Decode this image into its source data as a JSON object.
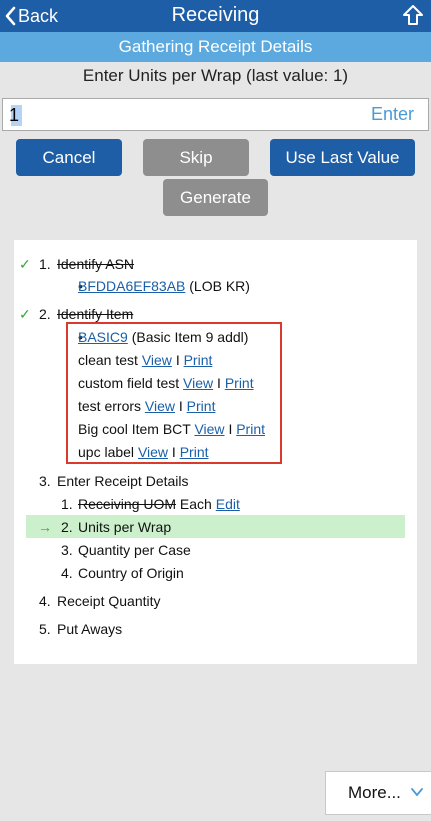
{
  "header": {
    "back_label": "Back",
    "title": "Receiving",
    "home_icon": "home-up-arrow-icon",
    "back_icon": "chevron-left-icon"
  },
  "subheader": {
    "title": "Gathering Receipt Details"
  },
  "prompt": {
    "text": "Enter Units per Wrap (last value: 1)"
  },
  "input": {
    "value": "1",
    "enter_label": "Enter"
  },
  "buttons": {
    "cancel": "Cancel",
    "skip": "Skip",
    "use_last": "Use Last Value",
    "generate": "Generate"
  },
  "steps": {
    "s1": {
      "num": "1.",
      "label": "Identify ASN",
      "asn_link": "BFDDA6EF83AB",
      "asn_note": "(LOB KR)"
    },
    "s2": {
      "num": "2.",
      "label": "Identify Item",
      "item_link": "BASIC9",
      "item_note": "(Basic Item 9 addl)",
      "labels": [
        {
          "name": "clean test",
          "view": "View",
          "sep": "I",
          "print": "Print"
        },
        {
          "name": "custom field test",
          "view": "View",
          "sep": "I",
          "print": "Print"
        },
        {
          "name": "test errors",
          "view": "View",
          "sep": "I",
          "print": "Print"
        },
        {
          "name": "Big cool Item BCT",
          "view": "View",
          "sep": "I",
          "print": "Print"
        },
        {
          "name": "upc label",
          "view": "View",
          "sep": "I",
          "print": "Print"
        }
      ]
    },
    "s3": {
      "num": "3.",
      "label": "Enter Receipt Details",
      "sub": [
        {
          "num": "1.",
          "label": "Receiving UOM",
          "value": "Each",
          "edit": "Edit"
        },
        {
          "num": "2.",
          "label": "Units per Wrap"
        },
        {
          "num": "3.",
          "label": "Quantity per Case"
        },
        {
          "num": "4.",
          "label": "Country of Origin"
        }
      ]
    },
    "s4": {
      "num": "4.",
      "label": "Receipt Quantity"
    },
    "s5": {
      "num": "5.",
      "label": "Put Aways"
    },
    "check_mark": "✓",
    "current_arrow": "→",
    "accent_green": "#3aa63a",
    "highlight_color": "#ccf0cc"
  },
  "more": {
    "label": "More...",
    "icon": "chevron-down-icon"
  },
  "colors": {
    "primary": "#1d5ea6",
    "secondary": "#5ba9df",
    "link": "#1a5fa8",
    "annotation_box": "#d93a2b"
  }
}
